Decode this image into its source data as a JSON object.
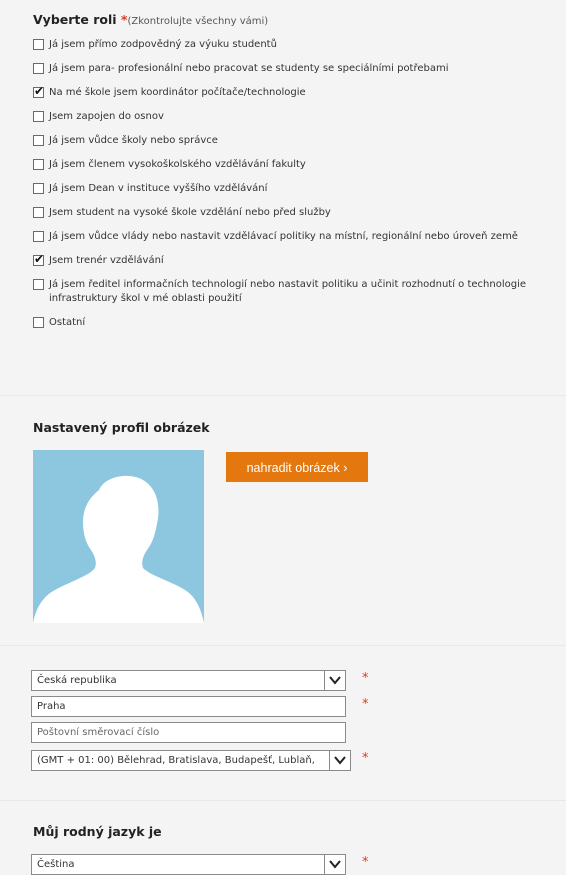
{
  "role": {
    "title": "Vyberte roli",
    "required_mark": "*",
    "note": "(Zkontrolujte všechny vámi)",
    "options": [
      {
        "label": "Já jsem přímo zodpovědný za výuku studentů",
        "checked": false
      },
      {
        "label": "Já jsem para- profesionální nebo pracovat se studenty se speciálními potřebami",
        "checked": false
      },
      {
        "label": "Na mé škole jsem koordinátor počítače/technologie",
        "checked": true
      },
      {
        "label": "Jsem zapojen do osnov",
        "checked": false
      },
      {
        "label": "Já jsem vůdce školy nebo správce",
        "checked": false
      },
      {
        "label": "Já jsem členem vysokoškolského vzdělávání fakulty",
        "checked": false
      },
      {
        "label": "Já jsem Dean v instituce vyššího vzdělávání",
        "checked": false
      },
      {
        "label": "Jsem student na vysoké škole vzdělání nebo před služby",
        "checked": false
      },
      {
        "label": "Já jsem vůdce vlády nebo nastavit vzdělávací politiky na místní, regionální nebo úroveň země",
        "checked": false
      },
      {
        "label": "Jsem trenér vzdělávání",
        "checked": true
      },
      {
        "label": "Já jsem ředitel informačních technologií nebo nastavit politiku a učinit rozhodnutí o technologie infrastruktury škol v mé oblasti použití",
        "checked": false
      },
      {
        "label": "Ostatní",
        "checked": false
      }
    ]
  },
  "profile": {
    "title": "Nastavený profil obrázek",
    "replace_button": "nahradit obrázek ›"
  },
  "location": {
    "country": "Česká republika",
    "city": "Praha",
    "postal_placeholder": "Poštovní směrovací číslo",
    "timezone": "(GMT + 01: 00) Bělehrad, Bratislava, Budapešť, Lublaň,",
    "required_mark": "*"
  },
  "language": {
    "title": "Můj rodný jazyk je",
    "value": "Čeština",
    "required_mark": "*"
  },
  "colors": {
    "accent": "#e4780e",
    "required": "#e03a1e",
    "avatar_bg": "#8cc6df"
  }
}
